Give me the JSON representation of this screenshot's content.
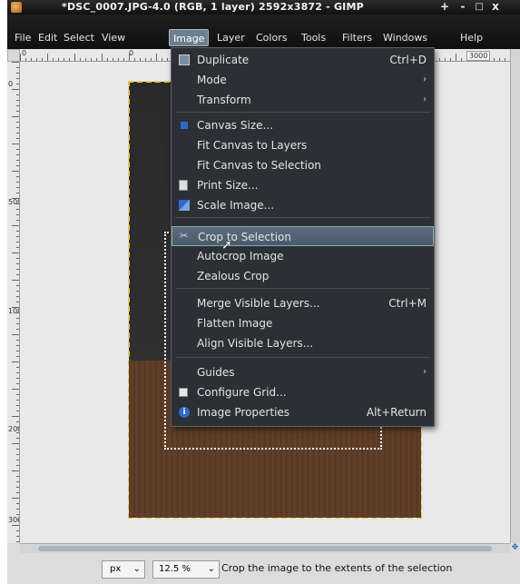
{
  "window": {
    "title": "*DSC_0007.JPG-4.0 (RGB, 1 layer) 2592x3872 - GIMP",
    "controls": {
      "plus": "+",
      "minimize": "-",
      "maximize": "□",
      "close": "x"
    }
  },
  "menubar": [
    {
      "label": "File"
    },
    {
      "label": "Edit"
    },
    {
      "label": "Select"
    },
    {
      "label": "View"
    },
    {
      "label": "Image"
    },
    {
      "label": "Layer"
    },
    {
      "label": "Colors"
    },
    {
      "label": "Tools"
    },
    {
      "label": "Filters"
    },
    {
      "label": "Windows"
    },
    {
      "label": "Help"
    }
  ],
  "rulers": {
    "h_labels": [
      "0",
      "0",
      "3000"
    ],
    "v_labels": [
      "0",
      "500",
      "1000",
      "2000",
      "3000"
    ]
  },
  "image_menu": {
    "items": [
      {
        "label": "Duplicate",
        "shortcut": "Ctrl+D",
        "icon": "duplicate-icon"
      },
      {
        "label": "Mode",
        "submenu": "›"
      },
      {
        "label": "Transform",
        "submenu": "›"
      },
      {
        "label": "Canvas Size...",
        "icon": "canvas-size-icon"
      },
      {
        "label": "Fit Canvas to Layers"
      },
      {
        "label": "Fit Canvas to Selection"
      },
      {
        "label": "Print Size...",
        "icon": "print-size-icon"
      },
      {
        "label": "Scale Image...",
        "icon": "scale-image-icon"
      },
      {
        "label": "Crop to Selection",
        "icon": "crop-icon",
        "highlighted": true
      },
      {
        "label": "Autocrop Image"
      },
      {
        "label": "Zealous Crop"
      },
      {
        "label": "Merge Visible Layers...",
        "shortcut": "Ctrl+M"
      },
      {
        "label": "Flatten Image"
      },
      {
        "label": "Align Visible Layers..."
      },
      {
        "label": "Guides",
        "submenu": "›"
      },
      {
        "label": "Configure Grid...",
        "icon": "grid-icon"
      },
      {
        "label": "Image Properties",
        "shortcut": "Alt+Return",
        "icon": "info-icon"
      }
    ]
  },
  "statusbar": {
    "unit": "px",
    "zoom": "12.5 %",
    "message": "Crop the image to the extents of the selection"
  },
  "colors": {
    "menu_bg": "#2c2f33",
    "highlight": "#5c6c7c",
    "selection_border": "#e8c84a"
  }
}
